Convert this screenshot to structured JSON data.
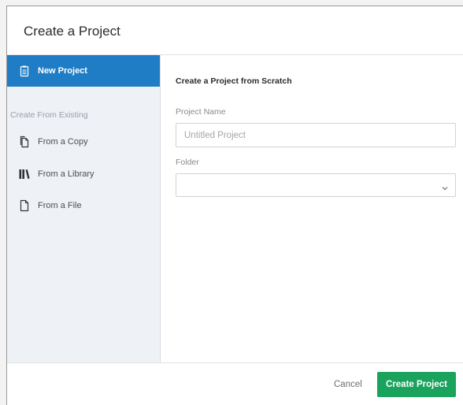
{
  "dialog": {
    "title": "Create a Project"
  },
  "sidebar": {
    "primary_item": {
      "label": "New Project",
      "icon": "clipboard-icon",
      "active": true
    },
    "section_label": "Create From Existing",
    "items": [
      {
        "label": "From a Copy",
        "icon": "copy-document-icon"
      },
      {
        "label": "From a Library",
        "icon": "library-books-icon"
      },
      {
        "label": "From a File",
        "icon": "file-icon"
      }
    ]
  },
  "main": {
    "section_title": "Create a Project from Scratch",
    "project_name": {
      "label": "Project Name",
      "value": "",
      "placeholder": "Untitled Project"
    },
    "folder": {
      "label": "Folder",
      "selected": "",
      "icon": "chevron-down-icon"
    }
  },
  "footer": {
    "cancel_label": "Cancel",
    "create_label": "Create Project"
  },
  "colors": {
    "accent_blue": "#1f7dc6",
    "primary_green": "#1aa35c",
    "sidebar_bg": "#eef2f7"
  }
}
